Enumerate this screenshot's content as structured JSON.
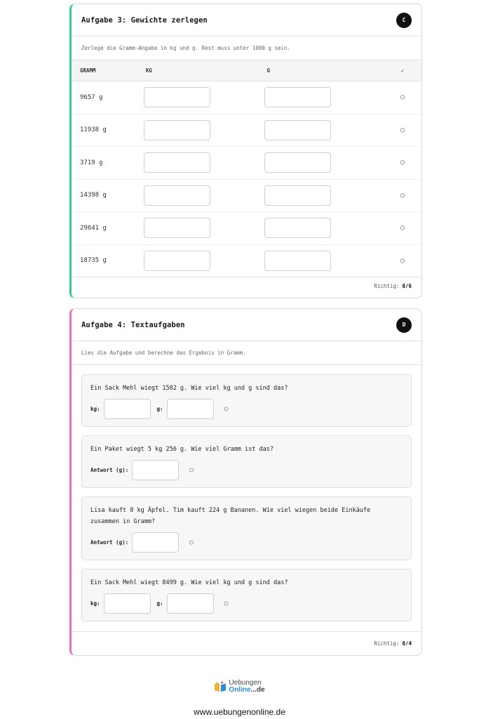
{
  "task3": {
    "title": "Aufgabe 3: Gewichte zerlegen",
    "badge": "C",
    "description": "Zerlege die Gramm-Angabe in kg und g. Rest muss unter 1000 g sein.",
    "columns": [
      "GRAMM",
      "KG",
      "G",
      "✓"
    ],
    "rows": [
      {
        "grams": "9657 g",
        "kg": "",
        "g": "",
        "status": "○"
      },
      {
        "grams": "11938 g",
        "kg": "",
        "g": "",
        "status": "○"
      },
      {
        "grams": "3719 g",
        "kg": "",
        "g": "",
        "status": "○"
      },
      {
        "grams": "14398 g",
        "kg": "",
        "g": "",
        "status": "○"
      },
      {
        "grams": "29641 g",
        "kg": "",
        "g": "",
        "status": "○"
      },
      {
        "grams": "18735 g",
        "kg": "",
        "g": "",
        "status": "○"
      }
    ],
    "score_label": "Richtig:",
    "score": "0/6"
  },
  "task4": {
    "title": "Aufgabe 4: Textaufgaben",
    "badge": "D",
    "description": "Lies die Aufgabe und berechne das Ergebnis in Gramm.",
    "problems": [
      {
        "text": "Ein Sack Mehl wiegt 1582 g. Wie viel kg und g sind das?",
        "kg_label": "kg:",
        "g_label": "g:",
        "status": "○"
      },
      {
        "text": "Ein Paket wiegt 5 kg 256 g. Wie viel Gramm ist das?",
        "answer_label": "Antwort (g):",
        "status": "○"
      },
      {
        "text": "Lisa kauft 8 kg Äpfel. Tim kauft 224 g Bananen. Wie viel wiegen beide Einkäufe zusammen in Gramm?",
        "answer_label": "Antwort (g):",
        "status": "○"
      },
      {
        "text": "Ein Sack Mehl wiegt 8499 g. Wie viel kg und g sind das?",
        "kg_label": "kg:",
        "g_label": "g:",
        "status": "○"
      }
    ],
    "score_label": "Richtig:",
    "score": "0/4"
  },
  "logo": {
    "top": "Uebungen",
    "bottom": "Online",
    "suffix": "...de"
  },
  "site_url": "www.uebungenonline.de",
  "colors": {
    "task3_accent": "#2fcf9b",
    "task4_accent": "#ef6fb4",
    "logo_blue": "#2a8bd6"
  }
}
